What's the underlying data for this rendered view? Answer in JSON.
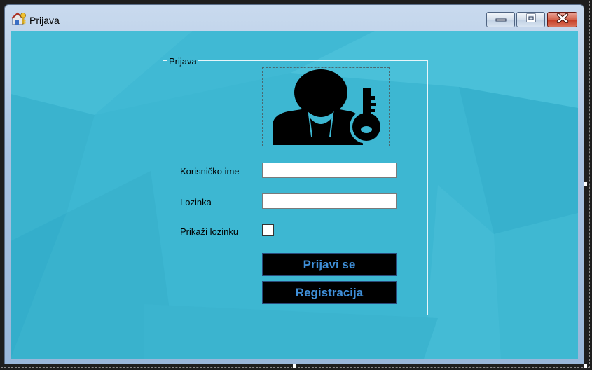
{
  "window": {
    "title": "Prijava",
    "controls": {
      "minimize": "minimize",
      "maximize": "maximize",
      "close": "close"
    }
  },
  "group": {
    "legend": "Prijava"
  },
  "form": {
    "username_label": "Korisničko ime",
    "username_value": "",
    "password_label": "Lozinka",
    "password_value": "",
    "show_password_label": "Prikaži lozinku",
    "show_password_checked": false
  },
  "buttons": {
    "login": "Prijavi se",
    "register": "Registracija"
  },
  "colors": {
    "background": "#3db7d2",
    "button_bg": "#000000",
    "button_text": "#3f8fd8"
  },
  "icons": {
    "app": "house-key-icon",
    "avatar": "user-key-icon"
  }
}
